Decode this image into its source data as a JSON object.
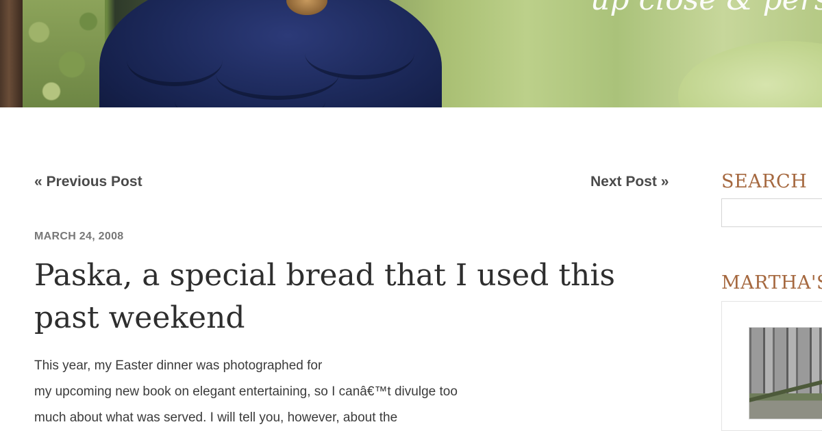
{
  "header": {
    "tagline": "up close & personal"
  },
  "post_nav": {
    "previous": "« Previous Post",
    "next": "Next Post »"
  },
  "post": {
    "date": "MARCH 24, 2008",
    "title": "Paska, a special bread that I used this past weekend",
    "body_lines": [
      "This year, my Easter dinner was photographed for",
      "my upcoming new book on elegant entertaining, so I canâ€™t divulge too",
      "much about what was served.  I will tell you, however, about the"
    ]
  },
  "sidebar": {
    "search_heading": "SEARCH",
    "search_placeholder": "",
    "section_heading": "MARTHA'S"
  },
  "colors": {
    "heading_accent": "#a5683f",
    "title_text": "#2e2e2e",
    "nav_text": "#4a4a4a",
    "date_text": "#777777"
  }
}
